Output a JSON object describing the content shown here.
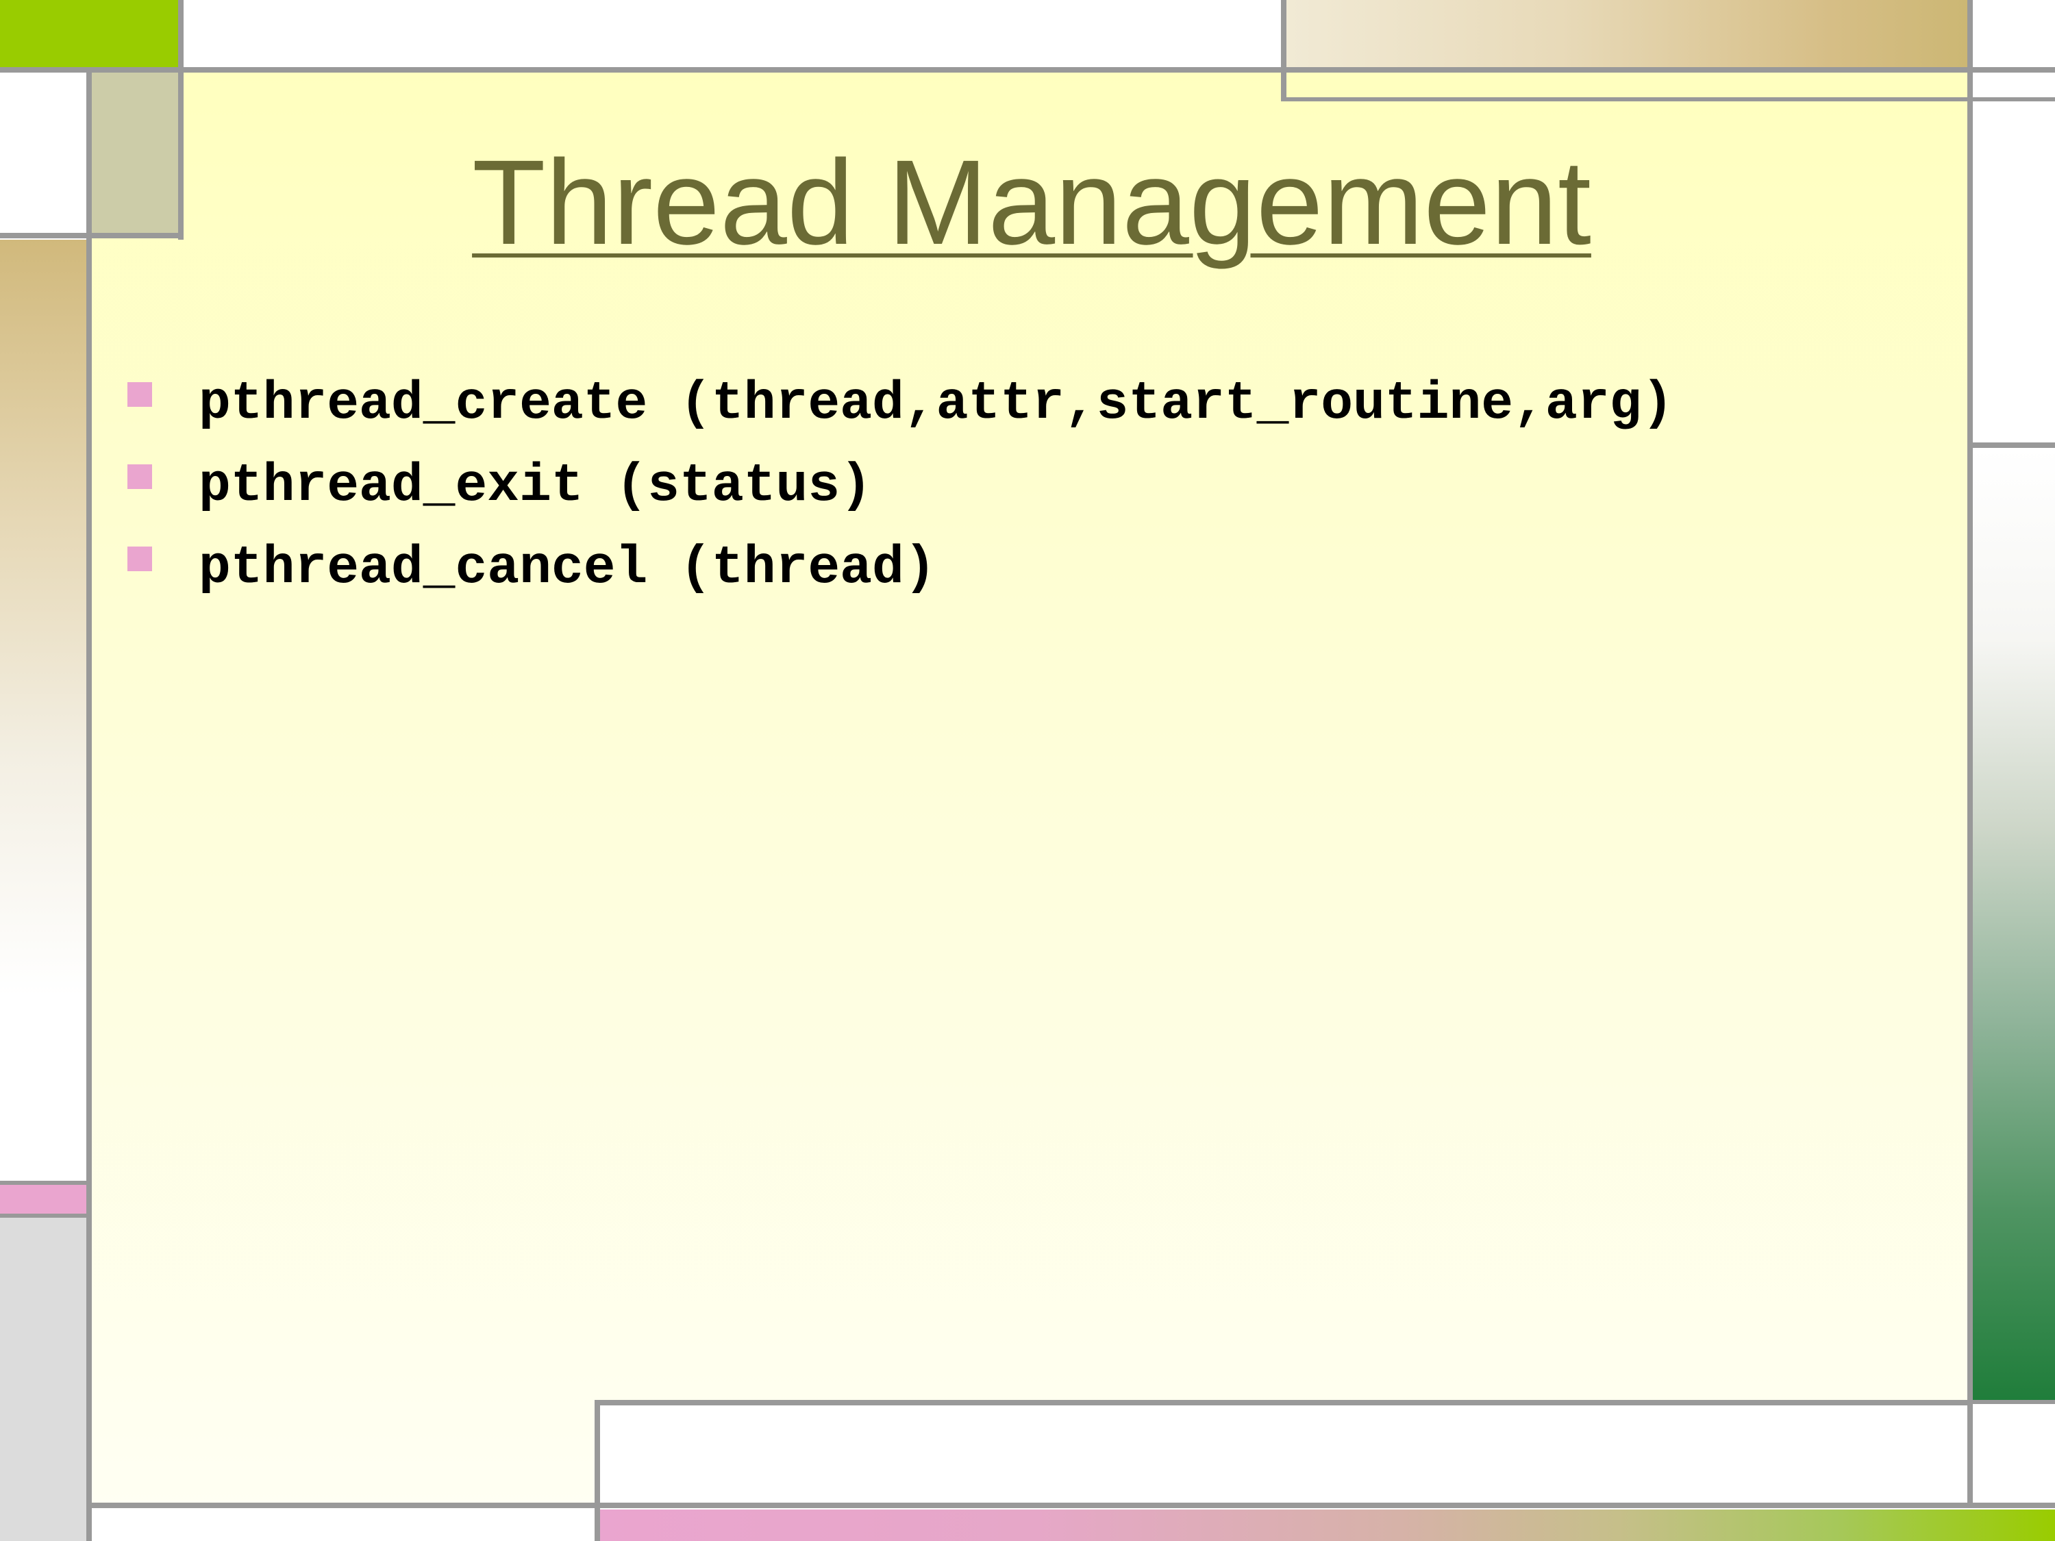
{
  "slide": {
    "title": "Thread Management",
    "bullets": [
      {
        "text": "pthread_create (thread,attr,start_routine,arg)"
      },
      {
        "text": "pthread_exit (status)"
      },
      {
        "text": "pthread_cancel (thread)"
      }
    ]
  },
  "colors": {
    "title": "#6b6b35",
    "bullet_marker": "#eaa5cf",
    "accent_green": "#99cc00",
    "accent_pink": "#eaa5cf",
    "accent_tan": "#d1b97c",
    "panel": "#ffffbf",
    "rule_lines": "#999999"
  }
}
